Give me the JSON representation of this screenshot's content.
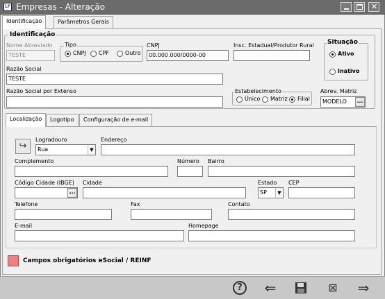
{
  "window": {
    "title": "Empresas - Alteração",
    "icon_text": "LF"
  },
  "top_tabs": [
    "Identificação",
    "Parâmetros Gerais"
  ],
  "identificacao": {
    "group_title": "Identificação",
    "nome_abreviado": {
      "label": "Nome Abreviado",
      "value": "TESTE"
    },
    "tipo": {
      "label": "Tipo",
      "options": [
        "CNPJ",
        "CPF",
        "Outro"
      ],
      "selected": "CNPJ"
    },
    "cnpj": {
      "label": "CNPJ",
      "value": "00.000.000/0000-00"
    },
    "insc_estadual": {
      "label": "Insc. Estadual/Produtor Rural",
      "value": ""
    },
    "situacao": {
      "label": "Situação",
      "options": [
        "Ativo",
        "Inativo"
      ],
      "selected": "Ativo"
    },
    "razao_social": {
      "label": "Razão Social",
      "value": "TESTE"
    },
    "razao_social_extenso": {
      "label": "Razão Social por Extenso",
      "value": ""
    },
    "estabelecimento": {
      "label": "Estabelecimento",
      "options": [
        "Único",
        "Matriz",
        "Filial"
      ],
      "selected": "Filial"
    },
    "abrev_matriz": {
      "label": "Abrev. Matriz",
      "value": "MODELO",
      "button": "..."
    }
  },
  "sub_tabs": [
    "Localização",
    "Logotipo",
    "Configuração de e-mail"
  ],
  "localizacao": {
    "logradouro": {
      "label": "Logradouro",
      "value": "Rua"
    },
    "endereco": {
      "label": "Endereço",
      "value": ""
    },
    "complemento": {
      "label": "Complemento",
      "value": ""
    },
    "numero": {
      "label": "Número",
      "value": ""
    },
    "bairro": {
      "label": "Bairro",
      "value": ""
    },
    "codigo_cidade": {
      "label": "Código Cidade (IBGE)",
      "value": "",
      "button": "..."
    },
    "cidade": {
      "label": "Cidade",
      "value": ""
    },
    "estado": {
      "label": "Estado",
      "value": "SP"
    },
    "cep": {
      "label": "CEP",
      "value": ""
    },
    "telefone": {
      "label": "Telefone",
      "value": ""
    },
    "fax": {
      "label": "Fax",
      "value": ""
    },
    "contato": {
      "label": "Contato",
      "value": ""
    },
    "email": {
      "label": "E-mail",
      "value": ""
    },
    "homepage": {
      "label": "Homepage",
      "value": ""
    }
  },
  "legend": {
    "text": "Campos obrigatórios eSocial / REINF",
    "color": "#f08080"
  },
  "toolbar": {
    "icons": [
      "help-icon",
      "back-arrow-icon",
      "save-icon",
      "cancel-icon",
      "forward-arrow-icon"
    ]
  },
  "colors": {
    "titlebar": "#6b6b6b",
    "window_bg": "#f0f0f0",
    "bottombar": "#c8c8c8"
  }
}
